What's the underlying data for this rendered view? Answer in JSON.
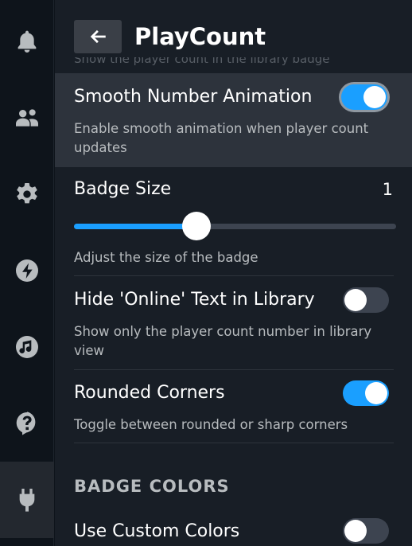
{
  "sidebar": {
    "items": [
      {
        "icon": "bell-icon",
        "active": false
      },
      {
        "icon": "friends-icon",
        "active": false
      },
      {
        "icon": "gear-icon",
        "active": false
      },
      {
        "icon": "lightning-icon",
        "active": false
      },
      {
        "icon": "music-icon",
        "active": false
      },
      {
        "icon": "help-icon",
        "active": false
      },
      {
        "icon": "plug-icon",
        "active": true
      }
    ]
  },
  "header": {
    "title": "PlayCount",
    "cut_off_text": "Show the player count in the library badge"
  },
  "settings": {
    "smooth_animation": {
      "title": "Smooth Number Animation",
      "description": "Enable smooth animation when player count updates",
      "enabled": true
    },
    "badge_size": {
      "title": "Badge Size",
      "value": "1",
      "description": "Adjust the size of the badge",
      "slider_fraction": 0.38
    },
    "hide_online": {
      "title": "Hide 'Online' Text in Library",
      "description": "Show only the player count number in library view",
      "enabled": false
    },
    "rounded_corners": {
      "title": "Rounded Corners",
      "description": "Toggle between rounded or sharp corners",
      "enabled": true
    }
  },
  "badge_colors": {
    "section_title": "BADGE COLORS",
    "custom_colors": {
      "title": "Use Custom Colors",
      "enabled": false
    }
  },
  "colors": {
    "accent": "#1a9fff",
    "background": "#181e26",
    "sidebar": "#0e141b",
    "highlight_row": "#2d333c"
  }
}
